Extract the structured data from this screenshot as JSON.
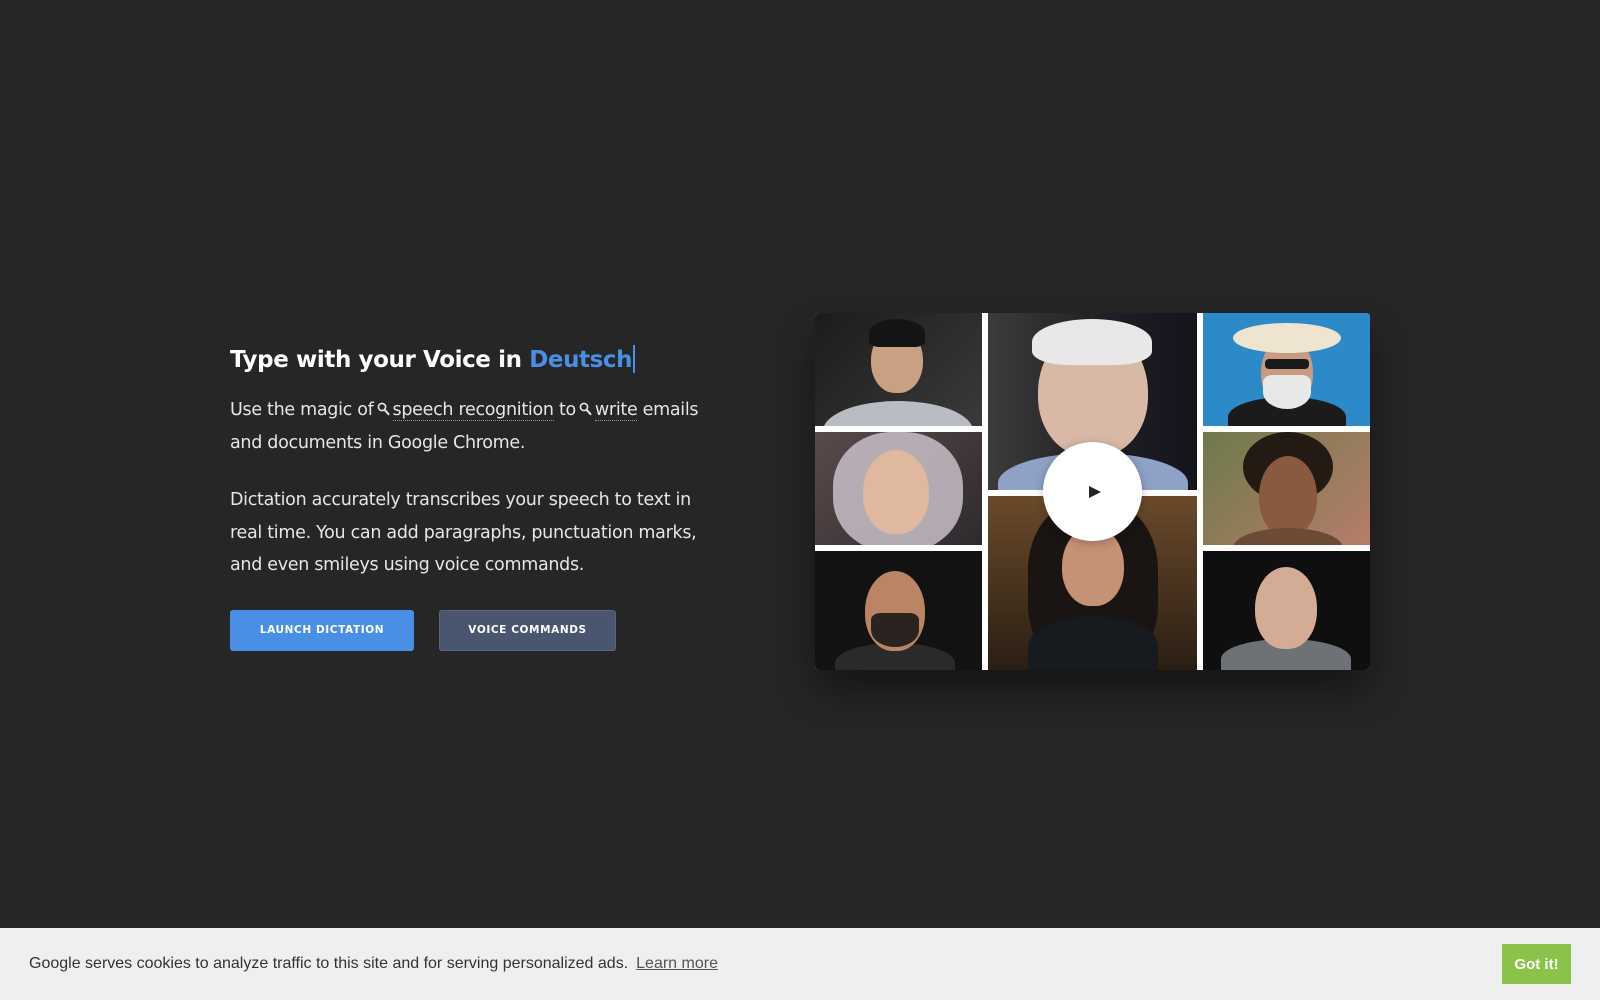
{
  "hero": {
    "headline_prefix": "Type with your Voice in",
    "language": "Deutsch",
    "lead_start": "Use the magic of",
    "link_speech": "speech recognition",
    "lead_mid": "to",
    "link_write": "write",
    "lead_end": "emails and documents in Google Chrome.",
    "description": "Dictation accurately transcribes your speech to text in real time. You can add paragraphs, punctuation marks, and even smileys using voice commands.",
    "primary_button": "LAUNCH DICTATION",
    "secondary_button": "VOICE COMMANDS"
  },
  "video": {
    "play_icon": "play-icon"
  },
  "cookie": {
    "message": "Google serves cookies to analyze traffic to this site and for serving personalized ads.",
    "learn_more": "Learn more",
    "accept": "Got it!"
  },
  "colors": {
    "background": "#262626",
    "accent": "#4a8fe6",
    "secondary_button": "#4a5670",
    "cookie_bar": "#efefef",
    "cookie_button": "#8bc34a"
  }
}
